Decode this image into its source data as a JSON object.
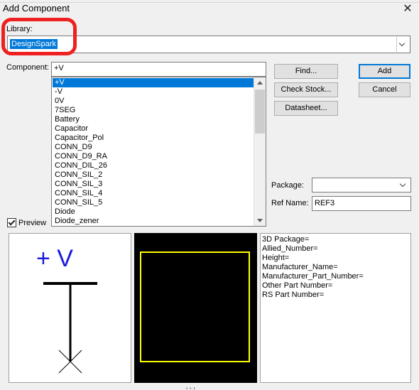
{
  "window": {
    "title": "Add Component",
    "bottom_cut_text": "' ' '"
  },
  "library": {
    "label": "Library:",
    "value": "DesignSpark"
  },
  "component": {
    "label": "Component:",
    "value": "+V",
    "items": [
      "+V",
      "-V",
      "0V",
      "7SEG",
      "Battery",
      "Capacitor",
      "Capacitor_Pol",
      "CONN_D9",
      "CONN_D9_RA",
      "CONN_DIL_26",
      "CONN_SIL_2",
      "CONN_SIL_3",
      "CONN_SIL_4",
      "CONN_SIL_5",
      "Diode",
      "Diode_zener"
    ],
    "selected_index": 0
  },
  "buttons": {
    "find": "Find...",
    "add": "Add",
    "check_stock": "Check Stock...",
    "cancel": "Cancel",
    "datasheet": "Datasheet..."
  },
  "package": {
    "label": "Package:",
    "value": ""
  },
  "ref_name": {
    "label": "Ref Name:",
    "value": "REF3"
  },
  "preview": {
    "label": "Preview",
    "checked": true,
    "symbol_text": "+ V"
  },
  "info": {
    "lines": [
      "3D Package=",
      "Allied_Number=",
      "Height=",
      "Manufacturer_Name=",
      "Manufacturer_Part_Number=",
      "Other Part Number=",
      "RS Part Number="
    ]
  },
  "colors": {
    "selection": "#0078d7",
    "highlight_ring": "#ee2020",
    "symbol_blue": "#1a1adc",
    "footprint_outline": "#ffff00"
  }
}
